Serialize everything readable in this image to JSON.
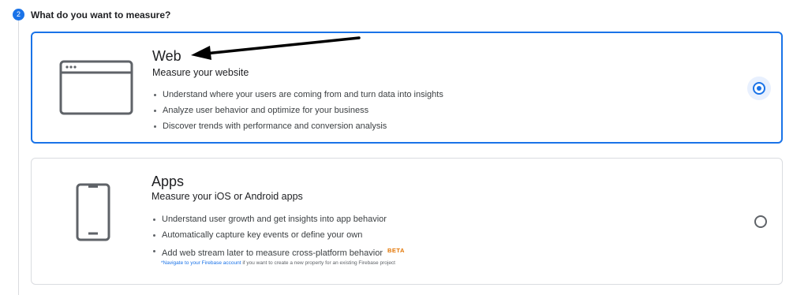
{
  "step": {
    "number": "2",
    "title": "What do you want to measure?"
  },
  "options": [
    {
      "title": "Web",
      "subtitle": "Measure your website",
      "icon": "browser-window-icon",
      "selected": true,
      "features": [
        "Understand where your users are coming from and turn data into insights",
        "Analyze user behavior and optimize for your business",
        "Discover trends with performance and conversion analysis"
      ]
    },
    {
      "title": "Apps",
      "subtitle": "Measure your iOS or Android apps",
      "icon": "mobile-phone-icon",
      "selected": false,
      "features": [
        "Understand user growth and get insights into app behavior",
        "Automatically capture key events or define your own",
        "Add web stream later to measure cross-platform behavior"
      ],
      "badge": "BETA",
      "note": {
        "link_text": "*Navigate to your Firebase account",
        "text": " if you want to create a new property for an existing Firebase project"
      }
    }
  ],
  "colors": {
    "accent": "#1a73e8",
    "accent_bg": "#e8f0fe",
    "badge": "#e37400",
    "border": "#dadce0"
  }
}
